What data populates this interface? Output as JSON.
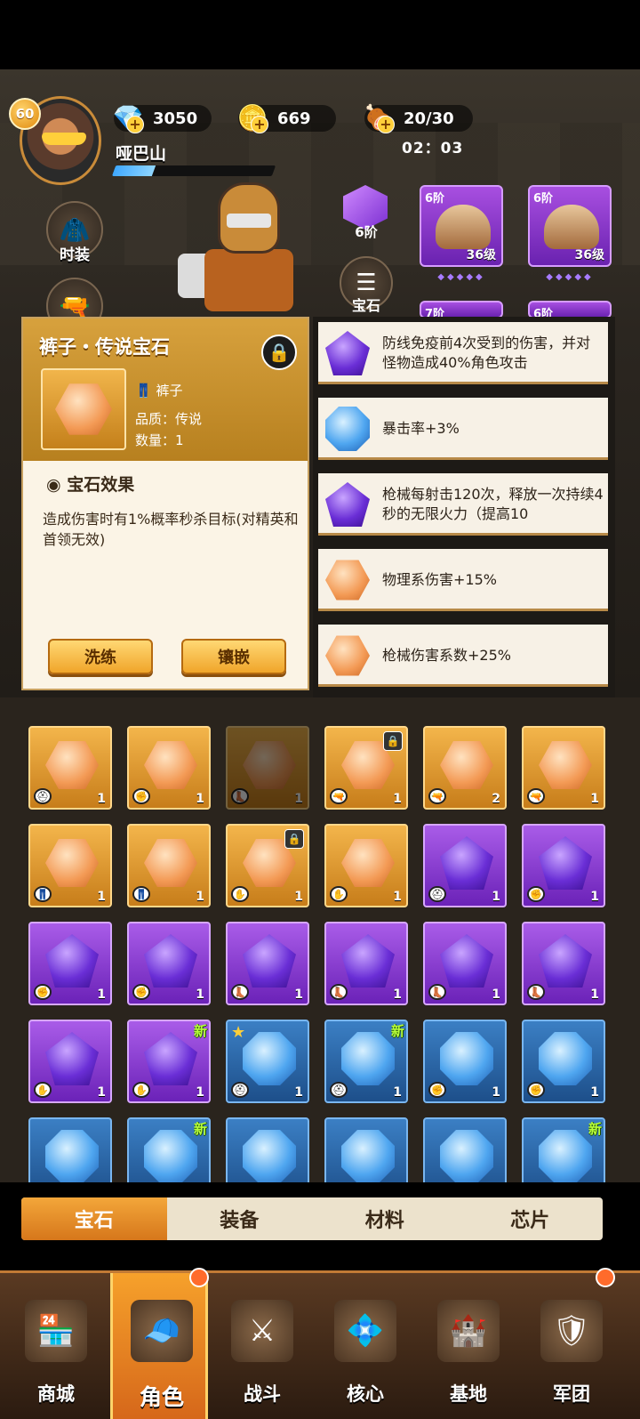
{
  "header": {
    "level": "60",
    "player_name": "哑巴山",
    "xp_progress": 0.25,
    "resources": {
      "diamond": "3050",
      "coin": "669",
      "food": "20/30"
    },
    "timer": "02：03"
  },
  "side_buttons": {
    "costume": "时装"
  },
  "hero_area": {
    "rank": "6阶",
    "menu_label": "宝石",
    "equipment": [
      {
        "tier": "6阶",
        "level": "36级"
      },
      {
        "tier": "6阶",
        "level": "36级"
      },
      {
        "tier": "7阶",
        "level": ""
      },
      {
        "tier": "6阶",
        "level": ""
      }
    ]
  },
  "detail": {
    "title": "裤子・传说宝石",
    "slot_name": "裤子",
    "quality_label": "品质：",
    "quality_value": "传说",
    "quantity_label": "数量：",
    "quantity_value": "1",
    "effect_title": "宝石效果",
    "effect_text": "造成伤害时有1%概率秒杀目标(对精英和首领无效)",
    "btn_refine": "洗练",
    "btn_inlay": "镶嵌"
  },
  "stats": [
    {
      "gem": "purple",
      "text": "防线免疫前4次受到的伤害，并对怪物造成40%角色攻击"
    },
    {
      "gem": "blue",
      "text": "暴击率+3%"
    },
    {
      "gem": "purple",
      "text": "枪械每射击120次，释放一次持续4秒的无限火力（提高10"
    },
    {
      "gem": "orange",
      "text": "物理系伤害+15%"
    },
    {
      "gem": "orange",
      "text": "枪械伤害系数+25%"
    }
  ],
  "grid": [
    [
      {
        "color": "orange",
        "part": "helmet",
        "count": "1",
        "flag": ""
      },
      {
        "color": "orange",
        "part": "gloves",
        "count": "1",
        "flag": ""
      },
      {
        "color": "orange",
        "part": "boots",
        "count": "1",
        "flag": "dim"
      },
      {
        "color": "orange",
        "part": "gun",
        "count": "1",
        "flag": "lock"
      },
      {
        "color": "orange",
        "part": "gun",
        "count": "2",
        "flag": ""
      },
      {
        "color": "orange",
        "part": "gun",
        "count": "1",
        "flag": ""
      }
    ],
    [
      {
        "color": "orange",
        "part": "pants",
        "count": "1",
        "flag": ""
      },
      {
        "color": "orange",
        "part": "pants",
        "count": "1",
        "flag": ""
      },
      {
        "color": "orange",
        "part": "hand",
        "count": "1",
        "flag": "lock"
      },
      {
        "color": "orange",
        "part": "hand",
        "count": "1",
        "flag": ""
      },
      {
        "color": "purple",
        "part": "helmet",
        "count": "1",
        "flag": ""
      },
      {
        "color": "purple",
        "part": "gloves",
        "count": "1",
        "flag": ""
      }
    ],
    [
      {
        "color": "purple",
        "part": "gloves",
        "count": "1",
        "flag": ""
      },
      {
        "color": "purple",
        "part": "gloves",
        "count": "1",
        "flag": ""
      },
      {
        "color": "purple",
        "part": "boots",
        "count": "1",
        "flag": ""
      },
      {
        "color": "purple",
        "part": "boots",
        "count": "1",
        "flag": ""
      },
      {
        "color": "purple",
        "part": "boots",
        "count": "1",
        "flag": ""
      },
      {
        "color": "purple",
        "part": "boots",
        "count": "1",
        "flag": ""
      }
    ],
    [
      {
        "color": "purple",
        "part": "hand",
        "count": "1",
        "flag": ""
      },
      {
        "color": "purple",
        "part": "hand",
        "count": "1",
        "flag": "new"
      },
      {
        "color": "blue",
        "part": "helmet",
        "count": "1",
        "flag": "star"
      },
      {
        "color": "blue",
        "part": "helmet",
        "count": "1",
        "flag": "new"
      },
      {
        "color": "blue",
        "part": "gloves",
        "count": "1",
        "flag": ""
      },
      {
        "color": "blue",
        "part": "gloves",
        "count": "1",
        "flag": ""
      }
    ],
    [
      {
        "color": "blue",
        "part": "",
        "count": "",
        "flag": ""
      },
      {
        "color": "blue",
        "part": "",
        "count": "",
        "flag": "new"
      },
      {
        "color": "blue",
        "part": "",
        "count": "",
        "flag": ""
      },
      {
        "color": "blue",
        "part": "",
        "count": "",
        "flag": ""
      },
      {
        "color": "blue",
        "part": "",
        "count": "",
        "flag": ""
      },
      {
        "color": "blue",
        "part": "",
        "count": "",
        "flag": "new"
      }
    ]
  ],
  "new_label": "新",
  "tabs": [
    "宝石",
    "装备",
    "材料",
    "芯片"
  ],
  "nav": [
    "商城",
    "角色",
    "战斗",
    "核心",
    "基地",
    "军团"
  ],
  "colors": {
    "accent": "#f3a73a",
    "orange_gem": "#f39a55",
    "purple_gem": "#6a2ed6",
    "blue_gem": "#4fa6f0"
  }
}
